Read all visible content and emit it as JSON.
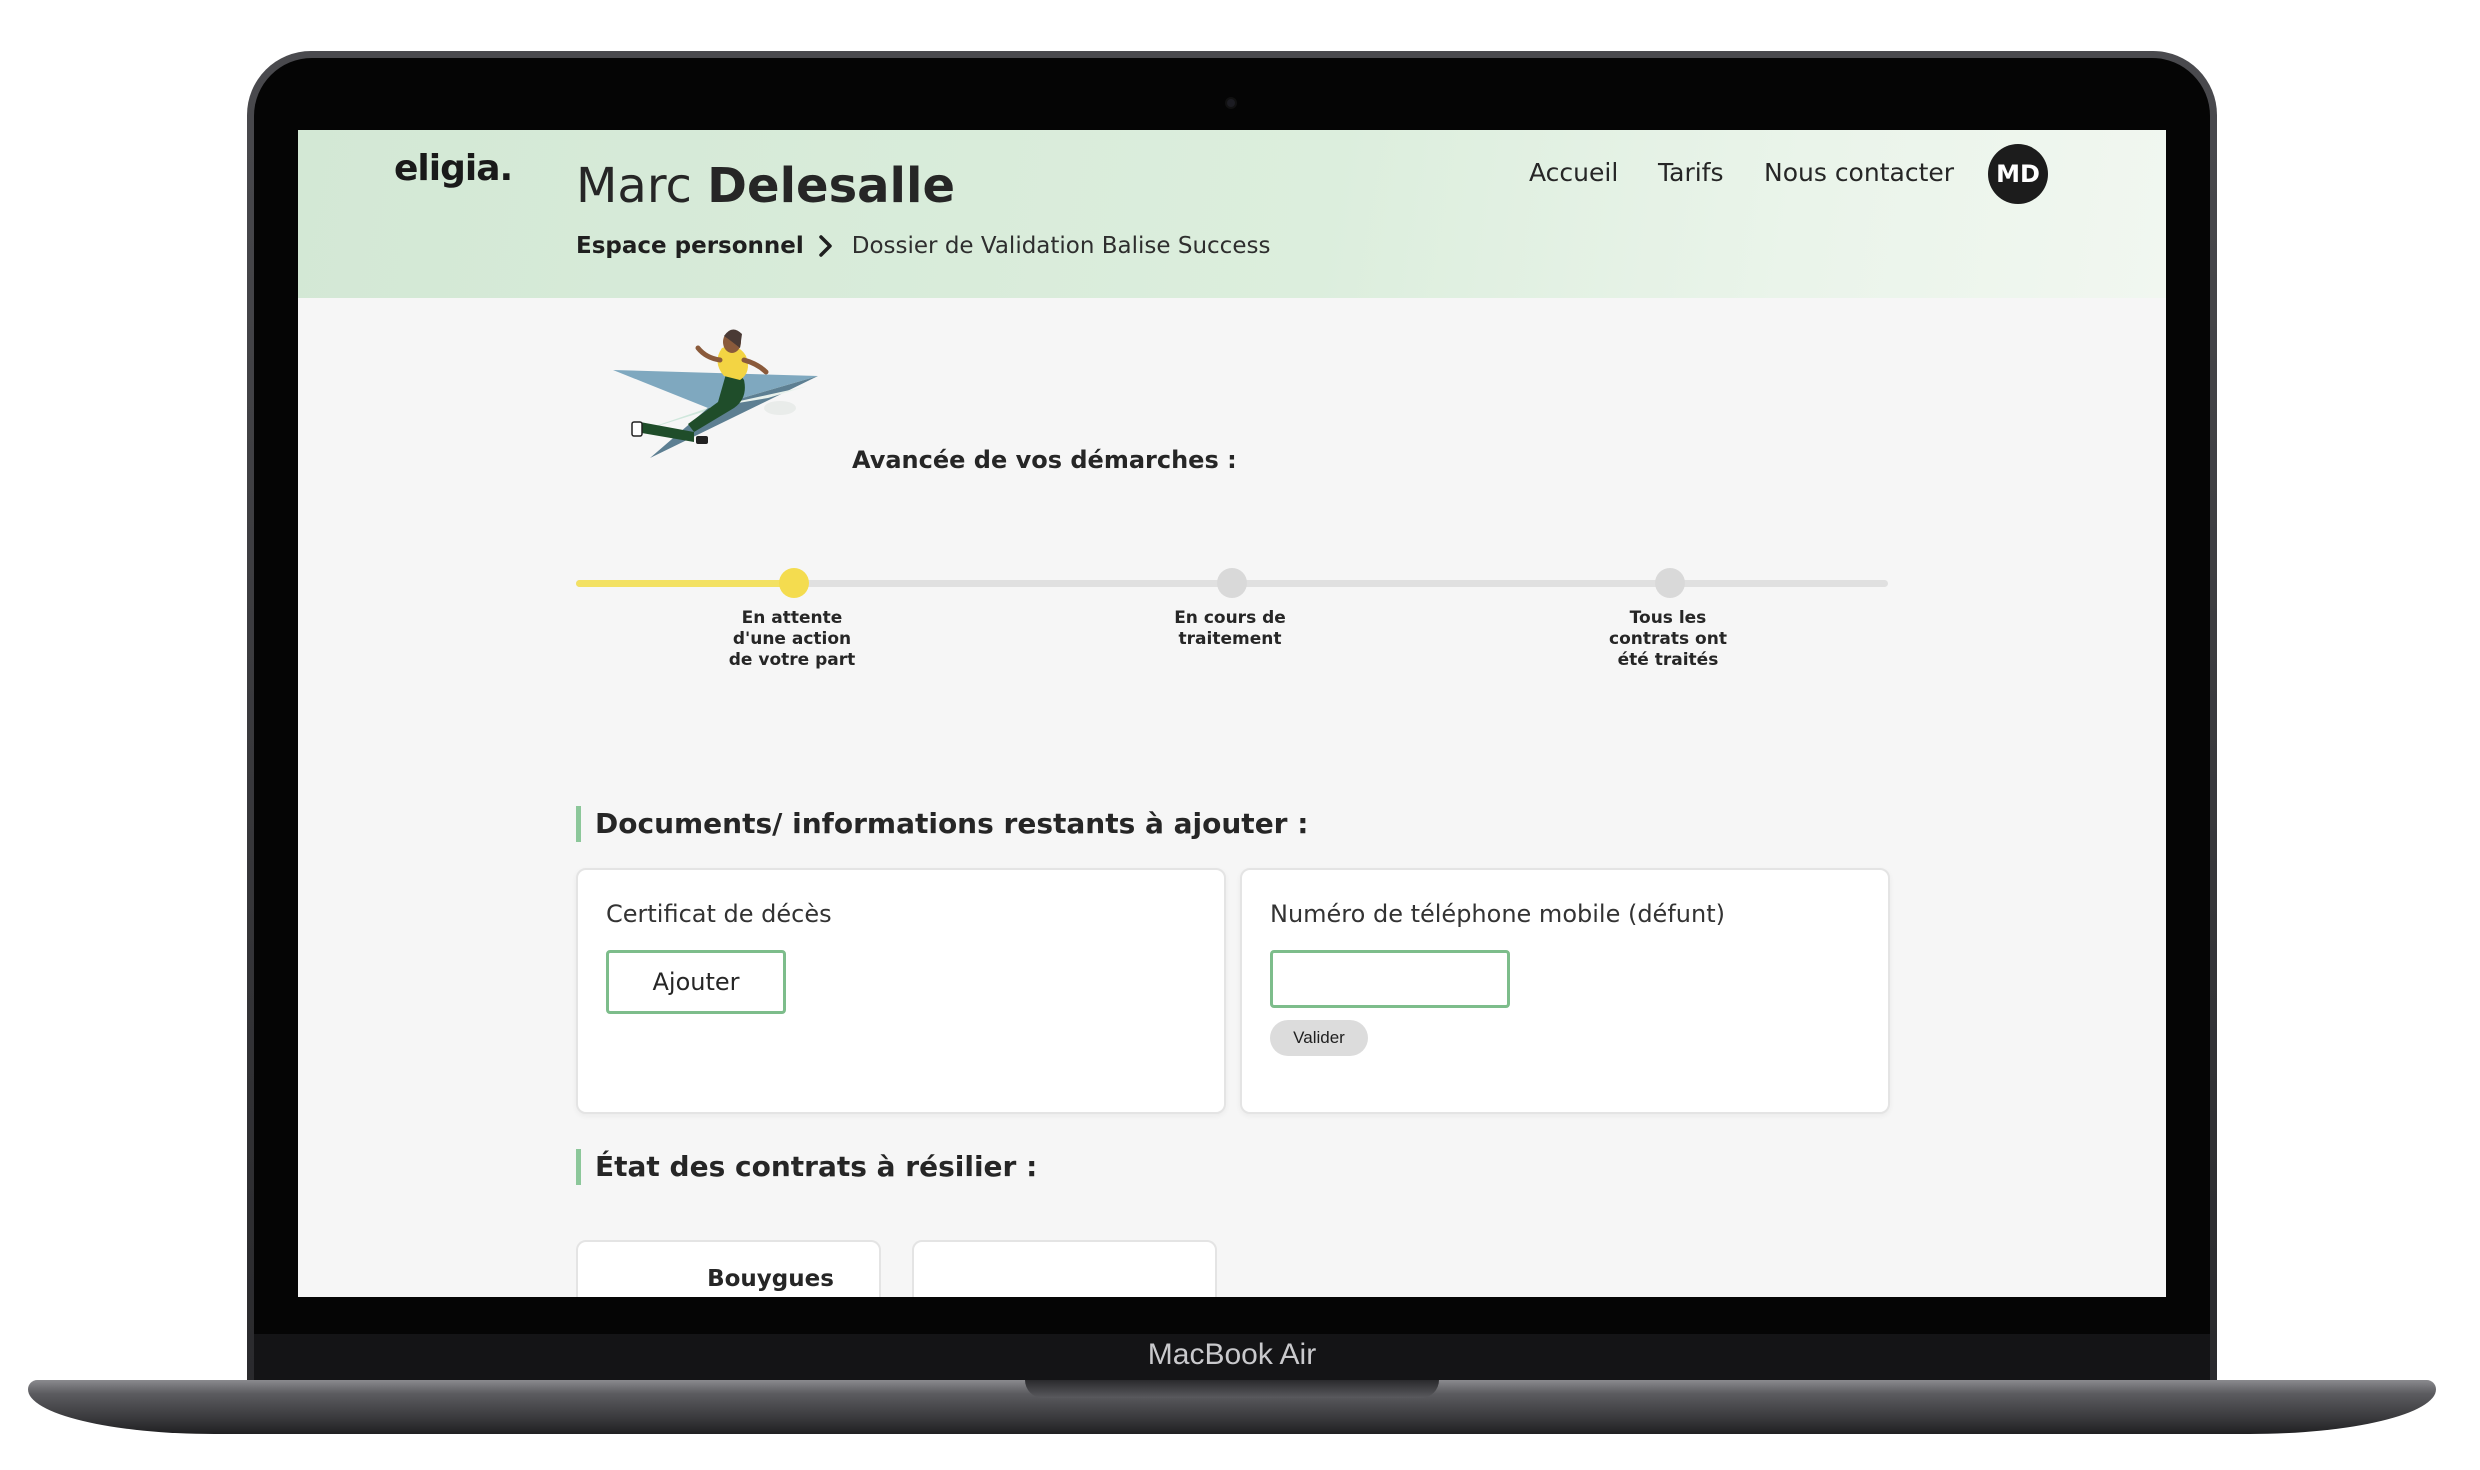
{
  "device": {
    "brand_label": "MacBook Air"
  },
  "header": {
    "logo": "eligia.",
    "user_first_name": "Marc",
    "user_last_name": "Delesalle",
    "breadcrumb": {
      "home": "Espace personnel",
      "current": "Dossier de Validation Balise Success"
    },
    "nav": [
      "Accueil",
      "Tarifs",
      "Nous contacter"
    ],
    "avatar_initials": "MD"
  },
  "progress": {
    "title": "Avancée de vos démarches :",
    "current_step": 1,
    "fill_fraction": 0.167,
    "steps": [
      {
        "label": "En attente d'une action de votre part"
      },
      {
        "label": "En cours de traitement"
      },
      {
        "label": "Tous les contrats ont été traités"
      }
    ],
    "colors": {
      "active": "#f4dc4f",
      "inactive": "#d9d9d9"
    }
  },
  "documents": {
    "title": "Documents/ informations restants à ajouter :",
    "items": [
      {
        "label": "Certificat de décès",
        "action": "Ajouter"
      },
      {
        "label": "Numéro de téléphone mobile (défunt)",
        "input_value": "",
        "action": "Valider"
      }
    ]
  },
  "contracts": {
    "title": "État des contrats à résilier :",
    "items": [
      "Bouygues"
    ]
  },
  "colors": {
    "accent_green": "#7dbd8b",
    "header_bg": "#d3e8d5",
    "progress_yellow": "#f3e163"
  }
}
